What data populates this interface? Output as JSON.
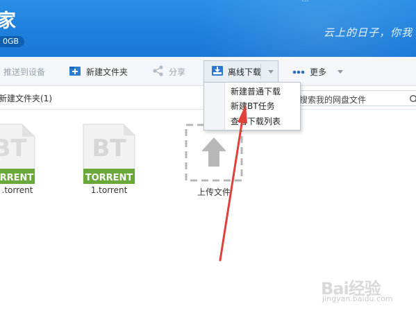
{
  "header": {
    "app_title": "家",
    "quota": "0GB",
    "slogan": "云上的日子，你我",
    "top_user": "..."
  },
  "toolbar": {
    "push_to_device": "推送到设备",
    "new_folder": "新建文件夹",
    "share": "分享",
    "offline_download": "离线下载",
    "more": "更多"
  },
  "offline_menu": {
    "items": [
      "新建普通下载",
      "新建BT任务",
      "查看下载列表"
    ]
  },
  "pathbar": {
    "path": "新建文件夹(1)",
    "search_placeholder": "搜索我的网盘文件"
  },
  "files": [
    {
      "name": ".torrent",
      "badge": "TORRENT",
      "glyph": "BT"
    },
    {
      "name": "1.torrent",
      "badge": "TORRENT",
      "glyph": "BT"
    },
    {
      "name": "上传文件"
    }
  ],
  "watermark": {
    "brand": "Bai经验",
    "url": "jingyan.baidu.com"
  },
  "colors": {
    "header_blue": "#1d7fdc",
    "torrent_green": "#6aa83a",
    "annotation_red": "#e0403a"
  }
}
